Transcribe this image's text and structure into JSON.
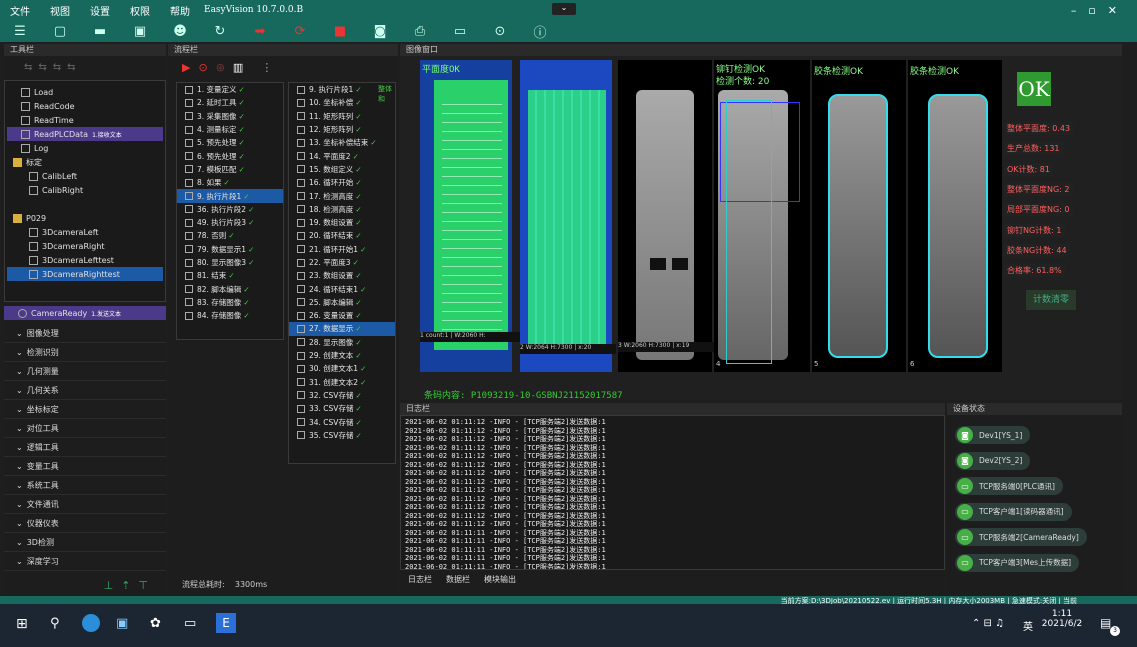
{
  "menu": {
    "items": [
      "文件",
      "视图",
      "设置",
      "权限",
      "帮助"
    ],
    "title": "EasyVision 10.7.0.0.B"
  },
  "toolbox": {
    "header": "工具栏",
    "tree": [
      {
        "label": "Load",
        "indent": 1
      },
      {
        "label": "ReadCode",
        "indent": 1
      },
      {
        "label": "ReadTime",
        "indent": 1
      },
      {
        "label": "ReadPLCData",
        "indent": 1,
        "badge": "1.接收文本",
        "purple": true
      },
      {
        "label": "Log",
        "indent": 1
      },
      {
        "label": "标定",
        "indent": 0,
        "folder": true
      },
      {
        "label": "CalibLeft",
        "indent": 2
      },
      {
        "label": "CalibRight",
        "indent": 2
      },
      {
        "label": "",
        "indent": 0
      },
      {
        "label": "P029",
        "indent": 0,
        "folder": true
      },
      {
        "label": "3DcameraLeft",
        "indent": 2
      },
      {
        "label": "3DcameraRight",
        "indent": 2
      },
      {
        "label": "3DcameraLefttest",
        "indent": 2
      },
      {
        "label": "3DcameraRighttest",
        "indent": 2,
        "selected": true
      }
    ],
    "camera_ready": {
      "label": "CameraReady",
      "badge": "1.发送文本"
    },
    "categories": [
      "图像处理",
      "检测识别",
      "几何测量",
      "几何关系",
      "坐标标定",
      "对位工具",
      "逻辑工具",
      "变量工具",
      "系统工具",
      "文件通讯",
      "仪器仪表",
      "3D检测",
      "深度学习"
    ]
  },
  "flow": {
    "header": "流程栏",
    "col1": [
      "1. 变量定义",
      "2. 延时工具",
      "3. 采集图像",
      "4. 测量标定",
      "5. 预先处理",
      "6. 预先处理",
      "7. 模板匹配",
      "8. 如果",
      "9. 执行片段1",
      "36. 执行片段2",
      "49. 执行片段3",
      "78. 否则",
      "79. 数据显示1",
      "80. 显示图像3",
      "81. 结束",
      "82. 脚本编辑",
      "83. 存储图像",
      "84. 存储图像"
    ],
    "col2": [
      "9. 执行片段1",
      "10. 坐标补偿",
      "11. 矩形阵列",
      "12. 矩形阵列",
      "13. 坐标补偿结束",
      "14. 平面度2",
      "15. 数组定义",
      "16. 循环开始",
      "17. 检测高度",
      "18. 检测高度",
      "19. 数组设置",
      "20. 循环结束",
      "21. 循环开始1",
      "22. 平面度3",
      "23. 数组设置",
      "24. 循环结束1",
      "25. 脚本编辑",
      "26. 变量设置",
      "27. 数据显示",
      "28. 显示图像",
      "29. 创建文本",
      "30. 创建文本1",
      "31. 创建文本2",
      "32. CSV存储",
      "33. CSV存储",
      "34. CSV存储",
      "35. CSV存储"
    ],
    "side_label": "整体和",
    "total_time_label": "流程总耗时:",
    "total_time": "3300ms"
  },
  "image": {
    "header": "图像窗口",
    "label1": "平面度OK",
    "label3": "铆钉检测OK",
    "label3b": "检测个数: 20",
    "label4": "胶条检测OK",
    "label5": "胶条检测OK",
    "info1": "1 count:1 | W:2060 H:",
    "info2": "2 W:2064 H:7300 | x:20",
    "info3": "3 W:2060 H:7300 | x:19",
    "n4": "4",
    "n5": "5",
    "n6": "6",
    "barcode": "条码内容: P1093219-10-GSBNJ21152017587",
    "ok": "OK",
    "stats": [
      "整体平面度: 0.43",
      "生产总数: 131",
      "OK计数: 81",
      "整体平面度NG: 2",
      "局部平面度NG: 0",
      "铆钉NG计数: 1",
      "胶条NG计数: 44",
      "合格率: 61.8%"
    ],
    "clear_button": "计数清零"
  },
  "log": {
    "header": "日志栏",
    "lines": [
      "2021-06-02 01:11:12 -INFO - [TCP服务端2]发送数据:1",
      "2021-06-02 01:11:12 -INFO - [TCP服务端2]发送数据:1",
      "2021-06-02 01:11:12 -INFO - [TCP服务端2]发送数据:1",
      "2021-06-02 01:11:12 -INFO - [TCP服务端2]发送数据:1",
      "2021-06-02 01:11:12 -INFO - [TCP服务端2]发送数据:1",
      "2021-06-02 01:11:12 -INFO - [TCP服务端2]发送数据:1",
      "2021-06-02 01:11:12 -INFO - [TCP服务端2]发送数据:1",
      "2021-06-02 01:11:12 -INFO - [TCP服务端2]发送数据:1",
      "2021-06-02 01:11:12 -INFO - [TCP服务端2]发送数据:1",
      "2021-06-02 01:11:12 -INFO - [TCP服务端2]发送数据:1",
      "2021-06-02 01:11:12 -INFO - [TCP服务端2]发送数据:1",
      "2021-06-02 01:11:12 -INFO - [TCP服务端2]发送数据:1",
      "2021-06-02 01:11:12 -INFO - [TCP服务端2]发送数据:1",
      "2021-06-02 01:11:11 -INFO - [TCP服务端2]发送数据:1",
      "2021-06-02 01:11:11 -INFO - [TCP服务端2]发送数据:1",
      "2021-06-02 01:11:11 -INFO - [TCP服务端2]发送数据:1",
      "2021-06-02 01:11:11 -INFO - [TCP服务端2]发送数据:1",
      "2021-06-02 01:11:11 -INFO - [TCP服务端2]发送数据:1",
      "2021-06-02 01:11:11 -INFO - [TCP服务端2]发送数据:1",
      "2021-06-02 01:11:11 -INFO - [TCP服务端2]发送数据:1"
    ],
    "tabs": [
      "日志栏",
      "数据栏",
      "模块输出"
    ]
  },
  "devices": {
    "header": "设备状态",
    "items": [
      "Dev1[YS_1]",
      "Dev2[YS_2]",
      "TCP服务端0[PLC通讯]",
      "TCP客户端1[读码器通讯]",
      "TCP服务端2[CameraReady]",
      "TCP客户端3[Mes上传数据]"
    ]
  },
  "status": {
    "text": "当前方案:D:\\3DJob\\20210522.ev | 运行时间5.3H | 内存大小2003MB | 急速模式:关闭 | 当前"
  },
  "taskbar": {
    "time": "1:11",
    "date": "2021/6/2",
    "ime": "英",
    "notif": "3"
  }
}
